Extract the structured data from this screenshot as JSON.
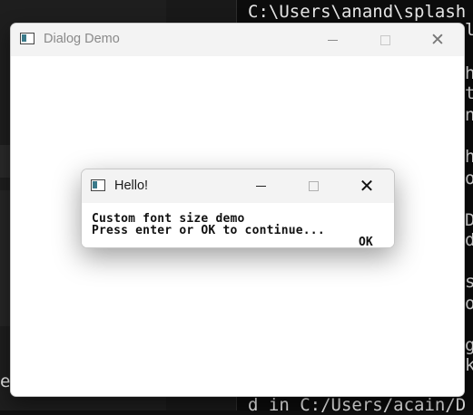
{
  "terminal": {
    "lines": [
      "C:\\Users\\anand\\splash",
      "d in C:/Users/acain/D"
    ],
    "right_fragments": [
      "l",
      "h",
      "t",
      "n",
      "h",
      "o",
      "D",
      "d",
      "s",
      "o",
      "g",
      "k"
    ],
    "left_fragment": "e"
  },
  "main_window": {
    "title": "Dialog Demo",
    "close_glyph": "✕"
  },
  "dialog": {
    "title": "Hello!",
    "message_line1": "Custom font size demo",
    "message_line2": "Press enter or OK to continue...",
    "ok_label": "OK",
    "close_glyph": "✕"
  },
  "colors": {
    "terminal_bg": "#0c0c0c",
    "titlebar_bg": "#f3f3f3",
    "icon_accent": "#3b7a8a"
  }
}
